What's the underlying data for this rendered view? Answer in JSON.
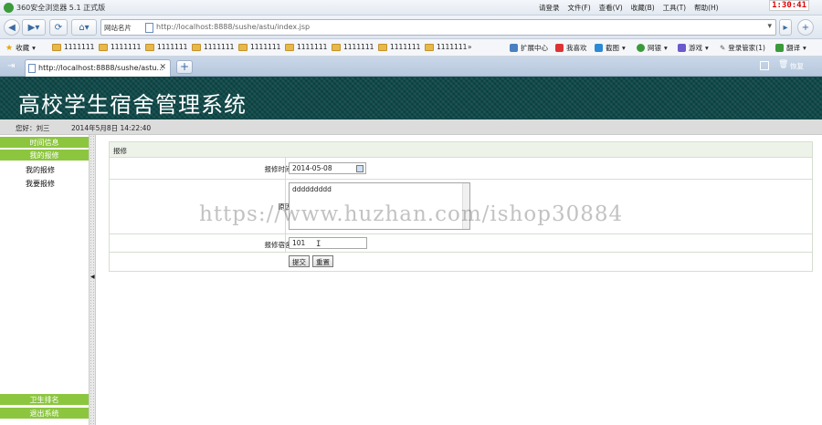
{
  "browser": {
    "title": "360安全浏览器 5.1 正式版",
    "menu": [
      "请登录",
      "文件(F)",
      "查看(V)",
      "收藏(B)",
      "工具(T)",
      "帮助(H)"
    ],
    "clock": "1:30:41",
    "address_label": "网站名片",
    "url": "http://localhost:8888/sushe/astu/index.jsp",
    "favorites_label": "收藏",
    "bookmarks": [
      "1111111",
      "1111111",
      "1111111",
      "1111111",
      "1111111",
      "1111111",
      "1111111",
      "1111111",
      "1111111"
    ],
    "right_tools": [
      "扩展中心",
      "我喜欢",
      "截图",
      "网银",
      "游戏",
      "登录管家(1)",
      "翻译"
    ],
    "tab_title": "http://localhost:8888/sushe/astu...",
    "restore_label": "恢复"
  },
  "page": {
    "system_title": "高校学生宿舍管理系统",
    "greeting": "您好：刘三",
    "datetime": "2014年5月8日   14:22:40"
  },
  "sidebar": {
    "sections": [
      "时间信息",
      "我的报修"
    ],
    "items": [
      "我的报修",
      "我要报修"
    ],
    "bottom": [
      "卫生排名",
      "退出系统"
    ]
  },
  "form": {
    "panel_title": "报修",
    "time_label": "报修时间：",
    "time_value": "2014-05-08",
    "reason_label": "原因：",
    "reason_value": "ddddddddd",
    "room_label": "报修宿舍：",
    "room_value": "101",
    "submit_label": "提交",
    "reset_label": "重置"
  },
  "watermark": "https://www.huzhan.com/ishop30884"
}
